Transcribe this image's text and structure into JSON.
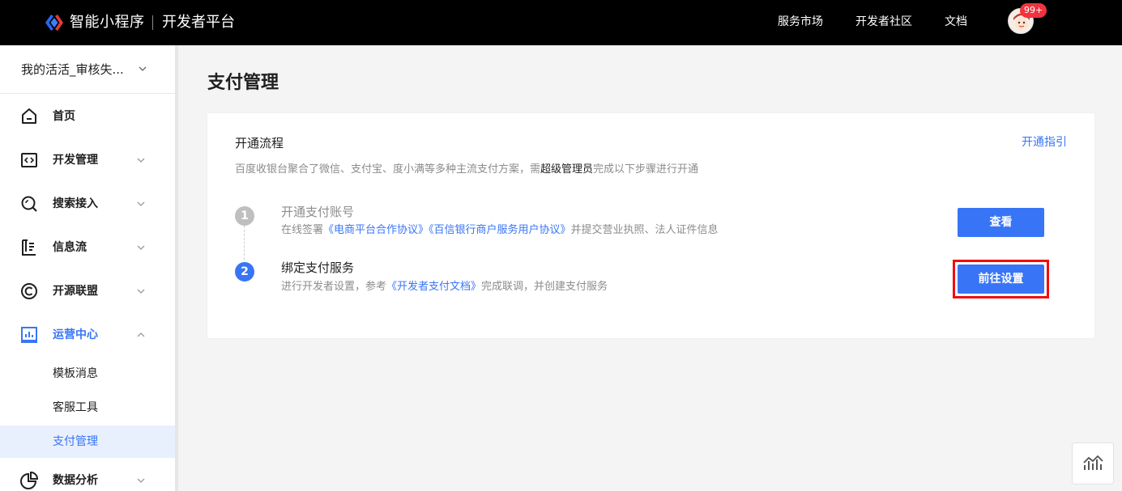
{
  "topbar": {
    "brand": "智能小程序",
    "platform": "开发者平台",
    "nav": [
      "服务市场",
      "开发者社区",
      "文档"
    ],
    "badge": "99+",
    "colors": {
      "background": "#000000",
      "badge": "#f0333f"
    }
  },
  "sidebar": {
    "app_switch": "我的活活_审核失...",
    "items": [
      {
        "label": "首页",
        "icon": "home-icon"
      },
      {
        "label": "开发管理",
        "icon": "code-icon"
      },
      {
        "label": "搜索接入",
        "icon": "search-icon"
      },
      {
        "label": "信息流",
        "icon": "feed-icon"
      },
      {
        "label": "开源联盟",
        "icon": "open-source-icon"
      },
      {
        "label": "运营中心",
        "icon": "operations-icon"
      },
      {
        "label": "数据分析",
        "icon": "data-analysis-icon"
      }
    ],
    "sub_items": [
      "模板消息",
      "客服工具",
      "支付管理"
    ],
    "selected_sub": "支付管理"
  },
  "main": {
    "page_title": "支付管理",
    "card": {
      "title": "开通流程",
      "guide_link": "开通指引",
      "desc_prefix": "百度收银台聚合了微信、支付宝、度小满等多种主流支付方案，需",
      "desc_strong": "超级管理员",
      "desc_suffix": "完成以下步骤进行开通",
      "steps": [
        {
          "num": "1",
          "title": "开通支付账号",
          "desc_prefix": "在线签署",
          "link1": "《电商平台合作协议》",
          "link2": "《百信银行商户服务用户协议》",
          "desc_suffix": "并提交营业执照、法人证件信息",
          "button": "查看"
        },
        {
          "num": "2",
          "title": "绑定支付服务",
          "desc_prefix": "进行开发者设置，参考",
          "link1": "《开发者支付文档》",
          "desc_suffix": "完成联调，并创建支付服务",
          "button": "前往设置"
        }
      ]
    }
  },
  "colors": {
    "accent": "#3875f6",
    "highlight": "#f20d0d",
    "step_done": "#bfbfbf"
  }
}
